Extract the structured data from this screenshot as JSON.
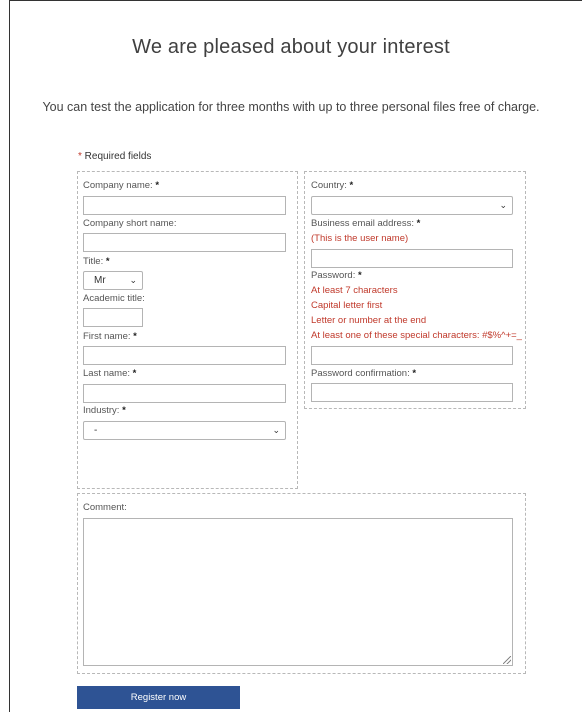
{
  "page": {
    "title": "We are pleased about your interest",
    "subtitle": "You can test the application for three months with up to three personal files free of charge."
  },
  "required_note": {
    "star": "*",
    "text": " Required fields"
  },
  "left": {
    "company_name": {
      "label": "Company name:",
      "star": "*",
      "value": ""
    },
    "company_short_name": {
      "label": "Company short name:",
      "value": ""
    },
    "title": {
      "label": "Title:",
      "star": "*",
      "selected": "Mr"
    },
    "academic_title": {
      "label": "Academic title:",
      "value": ""
    },
    "first_name": {
      "label": "First name:",
      "star": "*",
      "value": ""
    },
    "last_name": {
      "label": "Last name:",
      "star": "*",
      "value": ""
    },
    "industry": {
      "label": "Industry:",
      "star": "*",
      "selected": "-"
    }
  },
  "right": {
    "country": {
      "label": "Country:",
      "star": "*",
      "selected": ""
    },
    "business_email": {
      "label": "Business email address:",
      "star": "*",
      "hint": "(This is the user name)",
      "value": ""
    },
    "password": {
      "label": "Password:",
      "star": "*",
      "rules": [
        "At least 7 characters",
        "Capital letter first",
        "Letter or number at the end",
        "At least one of these special characters: #$%^+=_"
      ],
      "value": ""
    },
    "password_confirmation": {
      "label": "Password confirmation:",
      "star": "*",
      "value": ""
    }
  },
  "comment": {
    "label": "Comment:",
    "value": ""
  },
  "actions": {
    "register_label": "Register now"
  },
  "icons": {
    "dropdown": "chevron-down-icon",
    "resize": "resize-grip-icon"
  },
  "colors": {
    "required": "#c0392b",
    "button": "#2e5394",
    "hint": "#c0392b"
  }
}
